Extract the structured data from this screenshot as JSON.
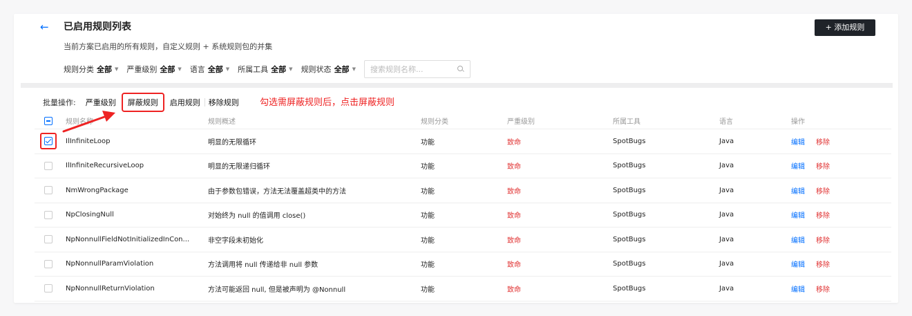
{
  "header": {
    "back_icon": "arrow-left-icon",
    "title": "已启用规则列表",
    "subtitle": "当前方案已启用的所有规则，自定义规则 + 系统规则包的并集",
    "add_button": "+ 添加规则"
  },
  "filters": [
    {
      "label": "规则分类",
      "value": "全部"
    },
    {
      "label": "严重级别",
      "value": "全部"
    },
    {
      "label": "语言",
      "value": "全部"
    },
    {
      "label": "所属工具",
      "value": "全部"
    },
    {
      "label": "规则状态",
      "value": "全部"
    }
  ],
  "search": {
    "placeholder": "搜索规则名称..."
  },
  "batch": {
    "label": "批量操作:",
    "severity": "严重级别",
    "block": "屏蔽规则",
    "enable": "启用规则",
    "remove": "移除规则"
  },
  "annotation": "勾选需屏蔽规则后，点击屏蔽规则",
  "colors": {
    "accent": "#006eff",
    "danger": "#e03030",
    "highlight": "#ee2222",
    "primary_button": "#1f2329"
  },
  "table": {
    "columns": {
      "name": "规则名称",
      "desc": "规则概述",
      "category": "规则分类",
      "severity": "严重级别",
      "tool": "所属工具",
      "language": "语言",
      "ops": "操作"
    },
    "edit": "编辑",
    "remove": "移除",
    "rows": [
      {
        "checked": true,
        "name": "IlInfiniteLoop",
        "desc": "明显的无限循环",
        "category": "功能",
        "severity": "致命",
        "tool": "SpotBugs",
        "language": "Java"
      },
      {
        "checked": false,
        "name": "IlInfiniteRecursiveLoop",
        "desc": "明显的无限递归循环",
        "category": "功能",
        "severity": "致命",
        "tool": "SpotBugs",
        "language": "Java"
      },
      {
        "checked": false,
        "name": "NmWrongPackage",
        "desc": "由于参数包错误，方法无法覆盖超类中的方法",
        "category": "功能",
        "severity": "致命",
        "tool": "SpotBugs",
        "language": "Java"
      },
      {
        "checked": false,
        "name": "NpClosingNull",
        "desc": "对始终为 null 的值调用 close()",
        "category": "功能",
        "severity": "致命",
        "tool": "SpotBugs",
        "language": "Java"
      },
      {
        "checked": false,
        "name": "NpNonnullFieldNotInitializedInCon...",
        "desc": "非空字段未初始化",
        "category": "功能",
        "severity": "致命",
        "tool": "SpotBugs",
        "language": "Java"
      },
      {
        "checked": false,
        "name": "NpNonnullParamViolation",
        "desc": "方法调用将 null 传递给非 null 参数",
        "category": "功能",
        "severity": "致命",
        "tool": "SpotBugs",
        "language": "Java"
      },
      {
        "checked": false,
        "name": "NpNonnullReturnViolation",
        "desc": "方法可能返回 null, 但是被声明为 @Nonnull",
        "category": "功能",
        "severity": "致命",
        "tool": "SpotBugs",
        "language": "Java"
      }
    ]
  }
}
